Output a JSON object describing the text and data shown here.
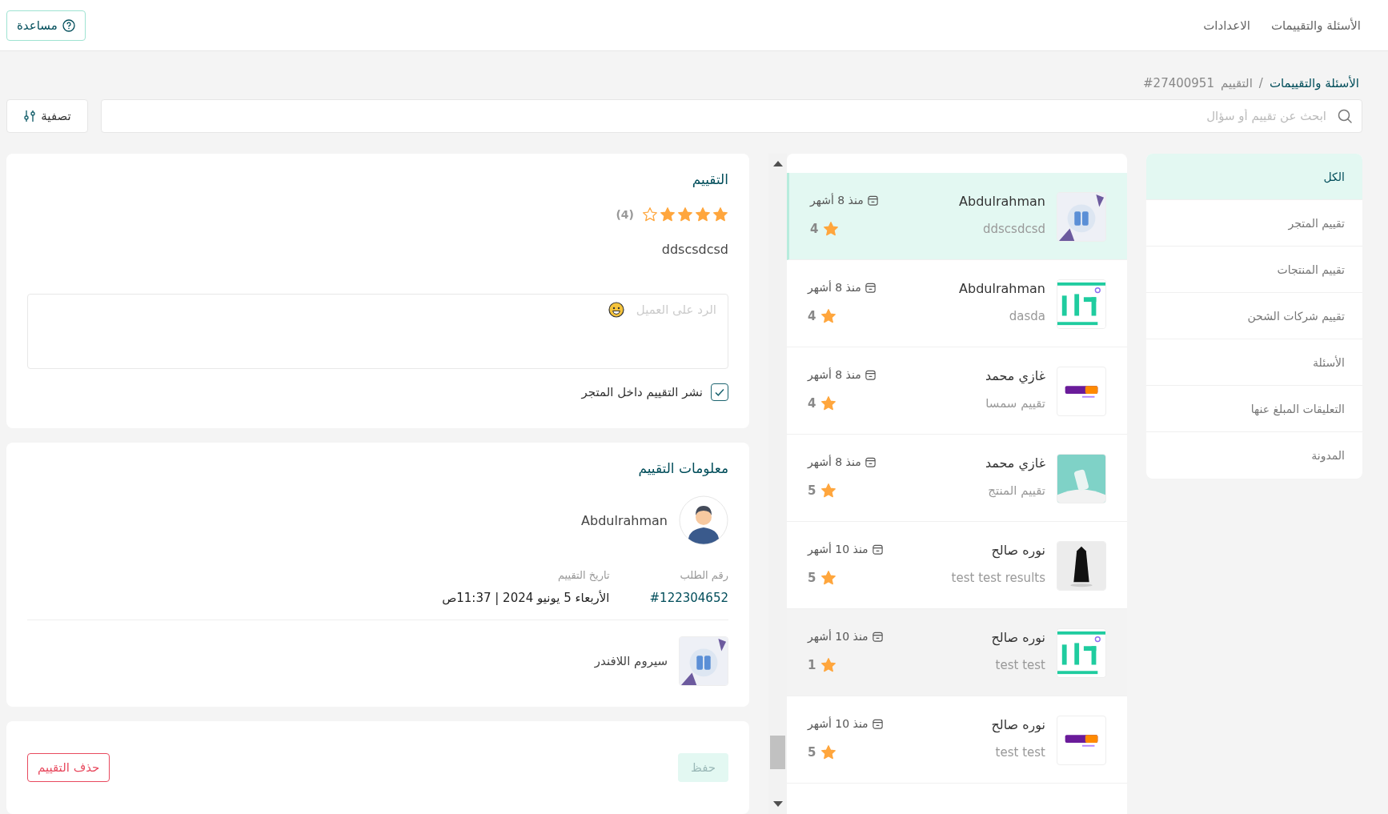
{
  "top_bar": {
    "nav": [
      {
        "label": "الأسئلة والتقييمات"
      },
      {
        "label": "الاعدادات"
      }
    ],
    "help_button": "مساعدة"
  },
  "breadcrumb": {
    "items": [
      {
        "label": "الأسئلة والتقييمات",
        "kind": "link"
      },
      {
        "label": "التقييم",
        "kind": "current"
      },
      {
        "label": "#27400951",
        "kind": "id"
      }
    ],
    "separator": "/"
  },
  "search": {
    "placeholder": "ابحث عن تقييم أو سؤال"
  },
  "filter_button": "تصفية",
  "sidebar": {
    "items": [
      {
        "label": "الكل",
        "selected": true
      },
      {
        "label": "تقييم المتجر",
        "selected": false
      },
      {
        "label": "تقييم المنتجات",
        "selected": false
      },
      {
        "label": "تقييم شركات الشحن",
        "selected": false
      },
      {
        "label": "الأسئلة",
        "selected": false
      },
      {
        "label": "التعليقات المبلغ عنها",
        "selected": false
      },
      {
        "label": "المدونة",
        "selected": false
      }
    ]
  },
  "reviews": [
    {
      "name": "Abdulrahman",
      "excerpt": "ddscsdcsd",
      "time": "منذ 8 أشهر",
      "rating": "4",
      "thumb": {
        "kind": "product"
      },
      "selected": true,
      "hovered": false
    },
    {
      "name": "Abdulrahman",
      "excerpt": "dasda",
      "time": "منذ 8 أشهر",
      "rating": "4",
      "thumb": {
        "kind": "store-logo"
      },
      "selected": false,
      "hovered": false
    },
    {
      "name": "غازي محمد",
      "excerpt": "تقييم سمسا",
      "time": "منذ 8 أشهر",
      "rating": "4",
      "thumb": {
        "kind": "shipping-logo"
      },
      "selected": false,
      "hovered": false
    },
    {
      "name": "غازي محمد",
      "excerpt": "تقييم المنتج",
      "time": "منذ 8 أشهر",
      "rating": "5",
      "thumb": {
        "kind": "bottle"
      },
      "selected": false,
      "hovered": false
    },
    {
      "name": "نوره صالح",
      "excerpt": "test test results",
      "time": "منذ 10 أشهر",
      "rating": "5",
      "thumb": {
        "kind": "figure"
      },
      "selected": false,
      "hovered": false
    },
    {
      "name": "نوره صالح",
      "excerpt": "test test",
      "time": "منذ 10 أشهر",
      "rating": "1",
      "thumb": {
        "kind": "store-logo"
      },
      "selected": false,
      "hovered": true
    },
    {
      "name": "نوره صالح",
      "excerpt": "test test",
      "time": "منذ 10 أشهر",
      "rating": "5",
      "thumb": {
        "kind": "shipping-logo"
      },
      "selected": false,
      "hovered": false
    }
  ],
  "rating_card": {
    "title": "التقييم",
    "stars": 4,
    "count": "(4)",
    "text": "ddscsdcsd",
    "reply": {
      "placeholder": "الرد على العميل"
    },
    "publish": {
      "label": "نشر التقييم داخل المتجر",
      "checked": true
    }
  },
  "info_card": {
    "title": "معلومات التقييم",
    "customer": "Abdulrahman",
    "fields": [
      {
        "label": "رقم الطلب",
        "value": "#122304652",
        "kind": "link"
      },
      {
        "label": "تاريخ التقييم",
        "value": "الأربعاء 5 يونيو 2024 | 11:37ص",
        "kind": "text"
      }
    ],
    "product": "سيروم اللافندر"
  },
  "actions": {
    "save": {
      "label": "حفظ",
      "disabled": true
    },
    "delete": {
      "label": "حذف التقييم"
    }
  }
}
